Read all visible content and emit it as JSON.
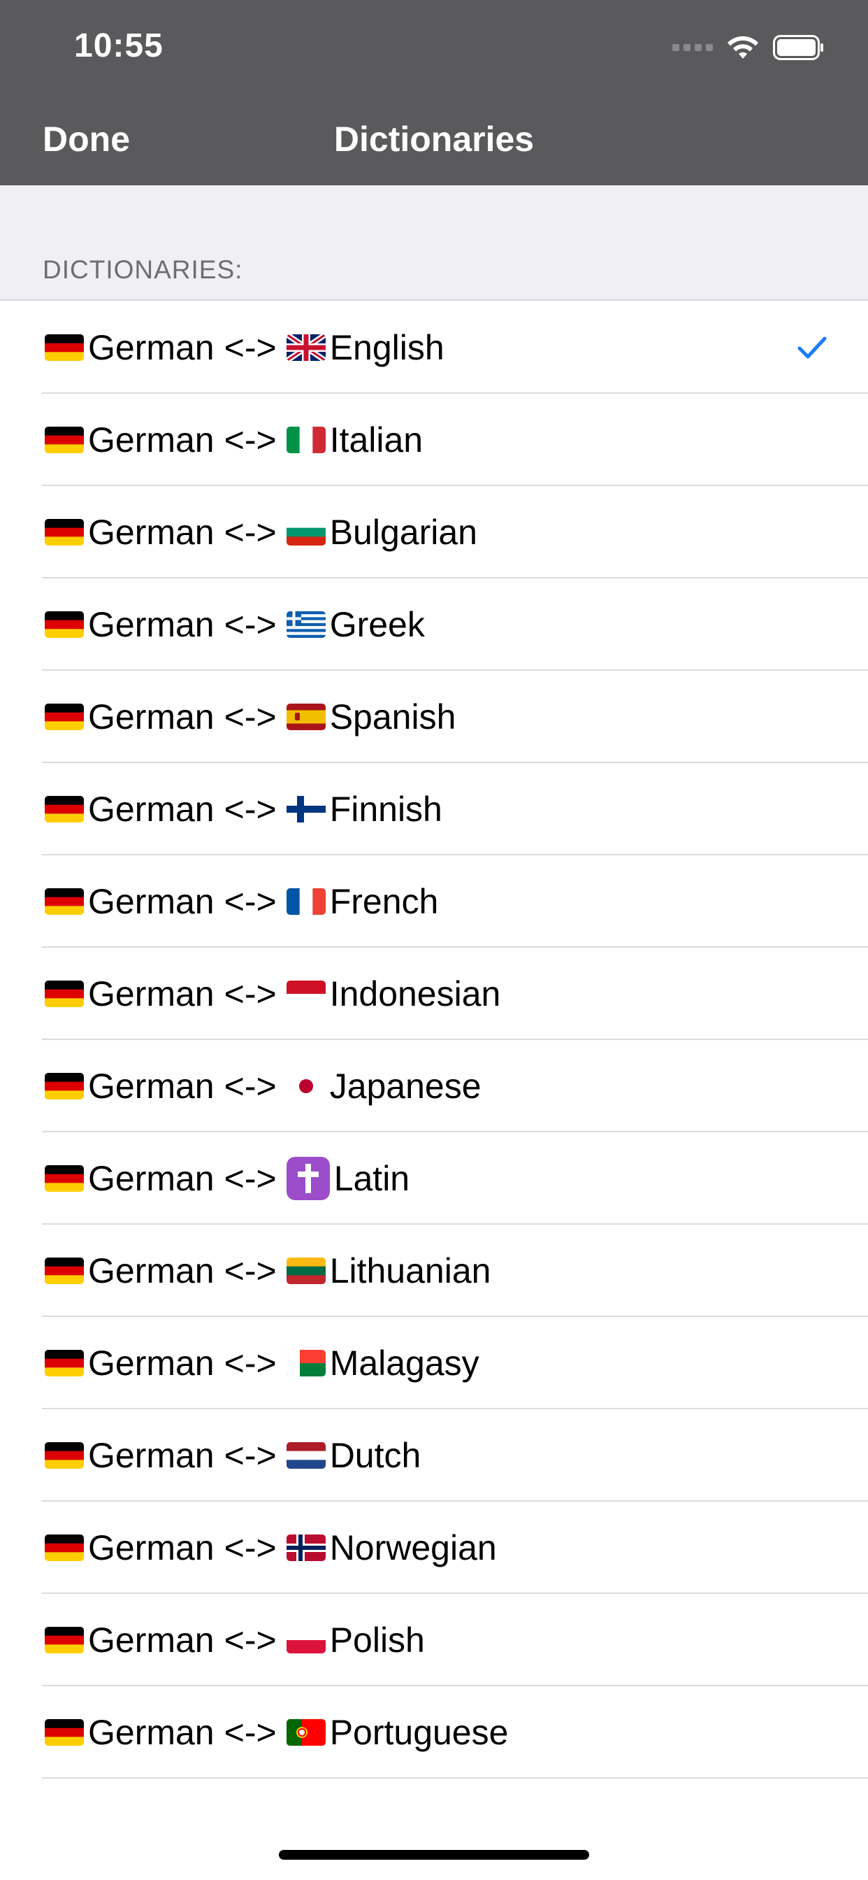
{
  "status_bar": {
    "time": "10:55",
    "signal_icon": "signal-bars-icon",
    "wifi_icon": "wifi-icon",
    "battery_icon": "battery-icon"
  },
  "nav": {
    "done_label": "Done",
    "title": "Dictionaries"
  },
  "section": {
    "title": "DICTIONARIES:"
  },
  "colors": {
    "header_bg": "#5a5a5c",
    "section_bg": "#efeff4",
    "check_accent": "#1a7cf5",
    "separator": "#dcdce0"
  },
  "dictionaries": [
    {
      "from": "German",
      "arrow": "<->",
      "to": "English",
      "to_flag": "uk-flag-icon",
      "selected": true
    },
    {
      "from": "German",
      "arrow": "<->",
      "to": "Italian",
      "to_flag": "italy-flag-icon",
      "selected": false
    },
    {
      "from": "German",
      "arrow": "<->",
      "to": "Bulgarian",
      "to_flag": "bulgaria-flag-icon",
      "selected": false
    },
    {
      "from": "German",
      "arrow": "<->",
      "to": "Greek",
      "to_flag": "greece-flag-icon",
      "selected": false
    },
    {
      "from": "German",
      "arrow": "<->",
      "to": "Spanish",
      "to_flag": "spain-flag-icon",
      "selected": false
    },
    {
      "from": "German",
      "arrow": "<->",
      "to": "Finnish",
      "to_flag": "finland-flag-icon",
      "selected": false
    },
    {
      "from": "German",
      "arrow": "<->",
      "to": "French",
      "to_flag": "france-flag-icon",
      "selected": false
    },
    {
      "from": "German",
      "arrow": "<->",
      "to": "Indonesian",
      "to_flag": "indonesia-flag-icon",
      "selected": false
    },
    {
      "from": "German",
      "arrow": "<->",
      "to": "Japanese",
      "to_flag": "japan-flag-icon",
      "selected": false
    },
    {
      "from": "German",
      "arrow": "<->",
      "to": "Latin",
      "to_flag": "latin-cross-icon",
      "selected": false
    },
    {
      "from": "German",
      "arrow": "<->",
      "to": "Lithuanian",
      "to_flag": "lithuania-flag-icon",
      "selected": false
    },
    {
      "from": "German",
      "arrow": "<->",
      "to": "Malagasy",
      "to_flag": "madagascar-flag-icon",
      "selected": false
    },
    {
      "from": "German",
      "arrow": "<->",
      "to": "Dutch",
      "to_flag": "netherlands-flag-icon",
      "selected": false
    },
    {
      "from": "German",
      "arrow": "<->",
      "to": "Norwegian",
      "to_flag": "norway-flag-icon",
      "selected": false
    },
    {
      "from": "German",
      "arrow": "<->",
      "to": "Polish",
      "to_flag": "poland-flag-icon",
      "selected": false
    },
    {
      "from": "German",
      "arrow": "<->",
      "to": "Portuguese",
      "to_flag": "portugal-flag-icon",
      "selected": false
    }
  ]
}
